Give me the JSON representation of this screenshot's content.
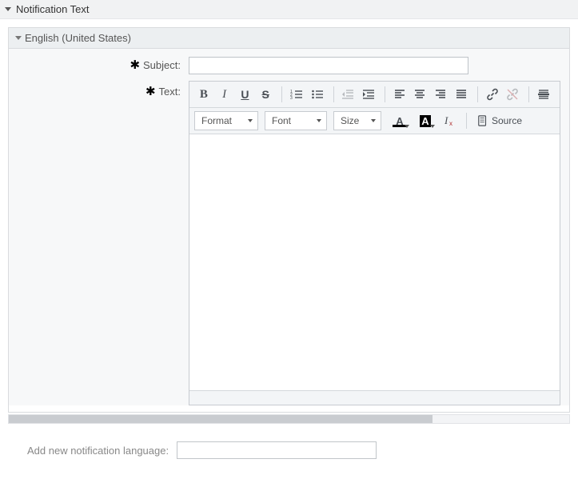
{
  "outer": {
    "title": "Notification Text"
  },
  "panel": {
    "title": "English (United States)"
  },
  "form": {
    "subject_label": "Subject:",
    "subject_value": "",
    "text_label": "Text:"
  },
  "toolbar": {
    "format_label": "Format",
    "font_label": "Font",
    "size_label": "Size",
    "source_label": "Source"
  },
  "bottom": {
    "label": "Add new notification language:",
    "value": ""
  },
  "colors": {
    "text_color_bar": "#000000",
    "bg_color_bar": "#000000"
  }
}
